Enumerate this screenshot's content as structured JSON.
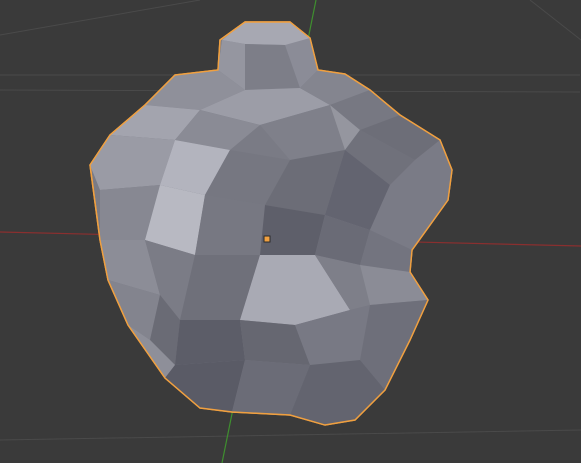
{
  "viewport": {
    "background": "#3a3a3a",
    "grid_color": "#4a4a4a",
    "x_axis_color": "#8a2f2f",
    "y_axis_color": "#3f8f2f",
    "selection_outline_color": "#f0a040",
    "origin_color": "#f0a040"
  },
  "object": {
    "name": "low-poly mesh",
    "shading": "solid",
    "selected": true
  }
}
